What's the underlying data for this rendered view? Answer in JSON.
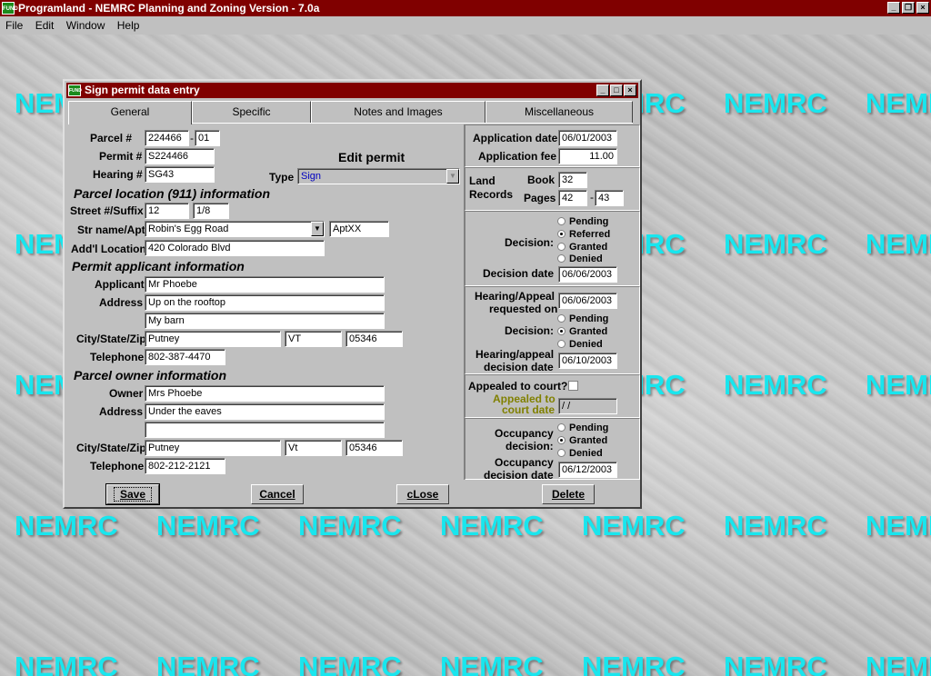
{
  "app": {
    "title": "Programland - NEMRC Planning and Zoning Version - 7.0a",
    "icon_text": "FUND",
    "menu": [
      "File",
      "Edit",
      "Window",
      "Help"
    ],
    "watermark": "NEMRC"
  },
  "dialog": {
    "title": "Sign permit data entry",
    "tabs": [
      "General",
      "Specific",
      "Notes and Images",
      "Miscellaneous"
    ],
    "heading": "Edit permit"
  },
  "left": {
    "parcel_label": "Parcel #",
    "parcel": "224466",
    "parcel_sep": "-",
    "parcel_suffix": "01",
    "permit_label": "Permit #",
    "permit": "S224466",
    "hearing_label": "Hearing #",
    "hearing": "SG43",
    "type_label": "Type",
    "type": "Sign",
    "location_header": "Parcel location (911) information",
    "street_label": "Street #/Suffix",
    "street_no": "12",
    "street_suffix": "1/8",
    "strname_label": "Str name/Apt",
    "strname": "Robin's Egg Road",
    "apt": "AptXX",
    "addl_label": "Add'l Location",
    "addl": "420 Colorado Blvd",
    "applicant_header": "Permit applicant information",
    "applicant_label": "Applicant",
    "applicant": "Mr Phoebe",
    "address_label": "Address",
    "address1": "Up on the rooftop",
    "address2": "My barn",
    "csz_label": "City/State/Zip",
    "city": "Putney",
    "state": "VT",
    "zip": "05346",
    "tel_label": "Telephone",
    "tel": "802-387-4470",
    "owner_header": "Parcel owner information",
    "owner_label": "Owner",
    "owner": "Mrs Phoebe",
    "o_address_label": "Address",
    "o_address1": "Under the eaves",
    "o_address2": "",
    "o_csz_label": "City/State/Zip",
    "o_city": "Putney",
    "o_state": "Vt",
    "o_zip": "05346",
    "o_tel_label": "Telephone",
    "o_tel": "802-212-2121"
  },
  "right": {
    "app_date_label": "Application date",
    "app_date": "06/01/2003",
    "app_fee_label": "Application fee",
    "app_fee": "11.00",
    "land_label1": "Land",
    "land_label2": "Records",
    "book_label": "Book",
    "book": "32",
    "pages_label": "Pages",
    "page_from": "42",
    "page_sep": "-",
    "page_to": "43",
    "decision_label": "Decision:",
    "decision_options": [
      "Pending",
      "Referred",
      "Granted",
      "Denied"
    ],
    "decision_selected": "Referred",
    "decision_date_label": "Decision date",
    "decision_date": "06/06/2003",
    "hearing_req_label1": "Hearing/Appeal",
    "hearing_req_label2": "requested on",
    "hearing_req": "06/06/2003",
    "h_decision_label": "Decision:",
    "h_decision_options": [
      "Pending",
      "Granted",
      "Denied"
    ],
    "h_decision_selected": "Granted",
    "h_date_label1": "Hearing/appeal",
    "h_date_label2": "decision date",
    "h_date": "06/10/2003",
    "appealed_label": "Appealed to court?",
    "appealed_checked": false,
    "appealed_date_label1": "Appealed to",
    "appealed_date_label2": "court date",
    "appealed_date": "/ /",
    "occ_label1": "Occupancy",
    "occ_label2": "decision:",
    "occ_options": [
      "Pending",
      "Granted",
      "Denied"
    ],
    "occ_selected": "Granted",
    "occ_date_label1": "Occupancy",
    "occ_date_label2": "decision date",
    "occ_date": "06/12/2003"
  },
  "buttons": {
    "save": "Save",
    "cancel": "Cancel",
    "close": "cLose",
    "delete": "Delete"
  }
}
